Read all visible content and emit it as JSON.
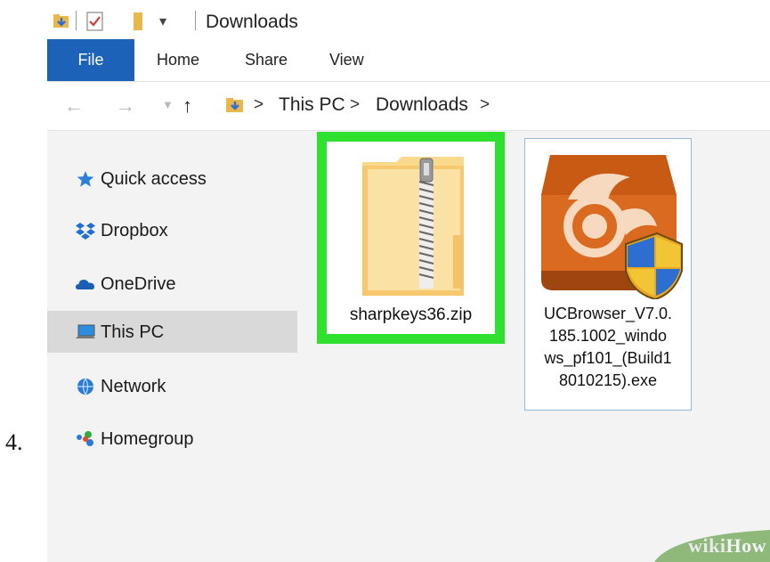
{
  "step_number": "4.",
  "window": {
    "title": "Downloads",
    "ribbon_tabs": [
      "File",
      "Home",
      "Share",
      "View"
    ],
    "address": {
      "path": [
        "This PC",
        "Downloads"
      ]
    },
    "sidebar": [
      {
        "label": "Quick access",
        "icon": "star-pin-icon"
      },
      {
        "label": "Dropbox",
        "icon": "dropbox-icon"
      },
      {
        "label": "OneDrive",
        "icon": "cloud-icon"
      },
      {
        "label": "This PC",
        "icon": "computer-icon",
        "selected": true
      },
      {
        "label": "Network",
        "icon": "network-icon"
      },
      {
        "label": "Homegroup",
        "icon": "homegroup-icon"
      }
    ],
    "files": [
      {
        "name": "sharpkeys36.zip",
        "icon": "zip-folder-icon",
        "highlighted": true
      },
      {
        "name": "UCBrowser_V7.0.185.1002_windows_pf101_(Build18010215).exe",
        "name_lines": [
          "UCBrowser_V7.0.",
          "185.1002_windo",
          "ws_pf101_(Build1",
          "8010215).exe"
        ],
        "icon": "ucbrowser-installer-icon"
      }
    ]
  },
  "watermark": {
    "prefix": "wiki",
    "suffix": "How"
  },
  "colors": {
    "file_tab": "#1b62b8",
    "highlight": "#2fe02f",
    "selection": "#d9d9d9"
  }
}
